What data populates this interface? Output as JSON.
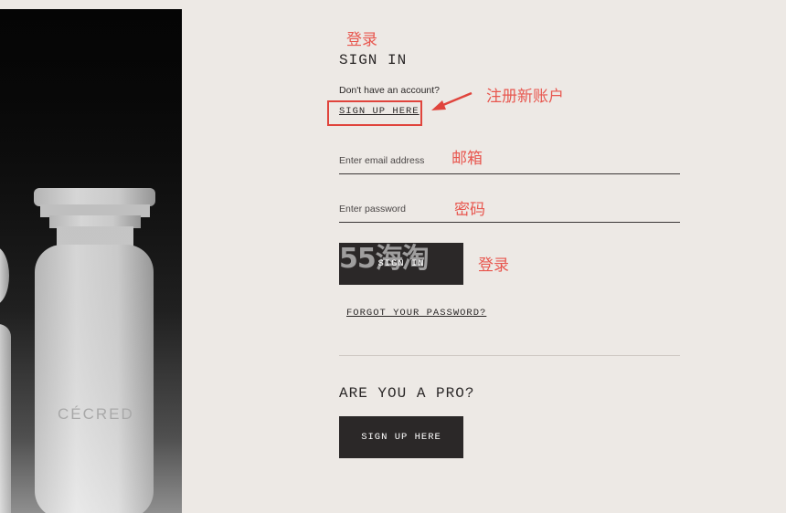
{
  "signin": {
    "heading": "SIGN IN",
    "no_account": "Don't have an account?",
    "signup_link": "SIGN UP HERE",
    "email_placeholder": "Enter email address",
    "password_placeholder": "Enter password",
    "signin_button": "SIGN IN",
    "forgot_link": "FORGOT YOUR PASSWORD?"
  },
  "pro": {
    "heading": "ARE YOU A PRO?",
    "signup_button": "SIGN UP HERE"
  },
  "product": {
    "brand_text": "CÉCRED"
  },
  "annotations": {
    "login_top": "登录",
    "register": "注册新账户",
    "email": "邮箱",
    "password": "密码",
    "login_button": "登录",
    "watermark": "55海淘"
  },
  "colors": {
    "background": "#ede9e5",
    "button": "#2b2828",
    "annotation": "#e8574f"
  }
}
